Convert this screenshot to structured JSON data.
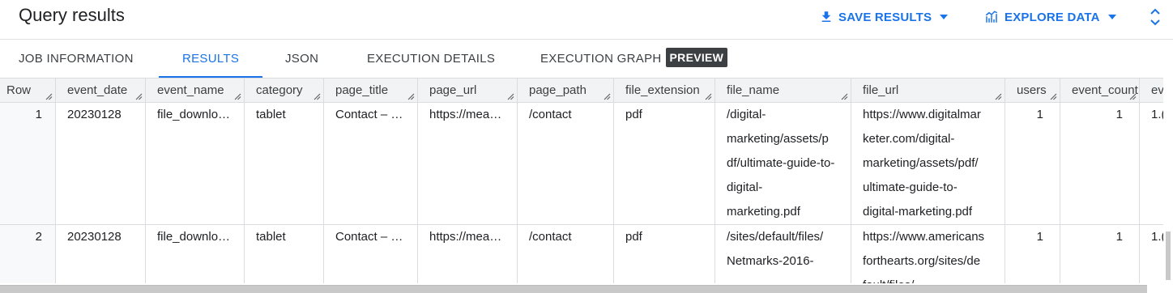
{
  "header": {
    "title": "Query results",
    "save_results": "SAVE RESULTS",
    "explore_data": "EXPLORE DATA"
  },
  "tabs": [
    {
      "label": "JOB INFORMATION"
    },
    {
      "label": "RESULTS"
    },
    {
      "label": "JSON"
    },
    {
      "label": "EXECUTION DETAILS"
    },
    {
      "label": "EXECUTION GRAPH"
    }
  ],
  "preview_badge": "PREVIEW",
  "active_tab": "RESULTS",
  "columns": [
    "Row",
    "event_date",
    "event_name",
    "category",
    "page_title",
    "page_url",
    "page_path",
    "file_extension",
    "file_name",
    "file_url",
    "users",
    "event_count",
    "ev"
  ],
  "rows": [
    {
      "row": "1",
      "event_date": "20230128",
      "event_name": "file_downlo…",
      "category": "tablet",
      "page_title": "Contact – …",
      "page_url": "https://mea…",
      "page_path": "/contact",
      "file_extension": "pdf",
      "file_name_lines": [
        "/digital-",
        "marketing/assets/p",
        "df/ultimate-guide-to-",
        "digital-",
        "marketing.pdf"
      ],
      "file_url_lines": [
        "https://www.digitalmar",
        "keter.com/digital-",
        "marketing/assets/pdf/",
        "ultimate-guide-to-",
        "digital-marketing.pdf"
      ],
      "users": "1",
      "event_count": "1",
      "ev": "1.("
    },
    {
      "row": "2",
      "event_date": "20230128",
      "event_name": "file_downlo…",
      "category": "tablet",
      "page_title": "Contact – …",
      "page_url": "https://mea…",
      "page_path": "/contact",
      "file_extension": "pdf",
      "file_name_lines": [
        "/sites/default/files/",
        "Netmarks-2016-",
        "…"
      ],
      "file_url_lines": [
        "https://www.americans",
        "forthearts.org/sites/de",
        "fault/files/…"
      ],
      "users": "1",
      "event_count": "1",
      "ev": "1.("
    }
  ],
  "colors": {
    "accent": "#1a73e8",
    "header_bg": "#f1f3f4",
    "badge_bg": "#3c4043"
  }
}
